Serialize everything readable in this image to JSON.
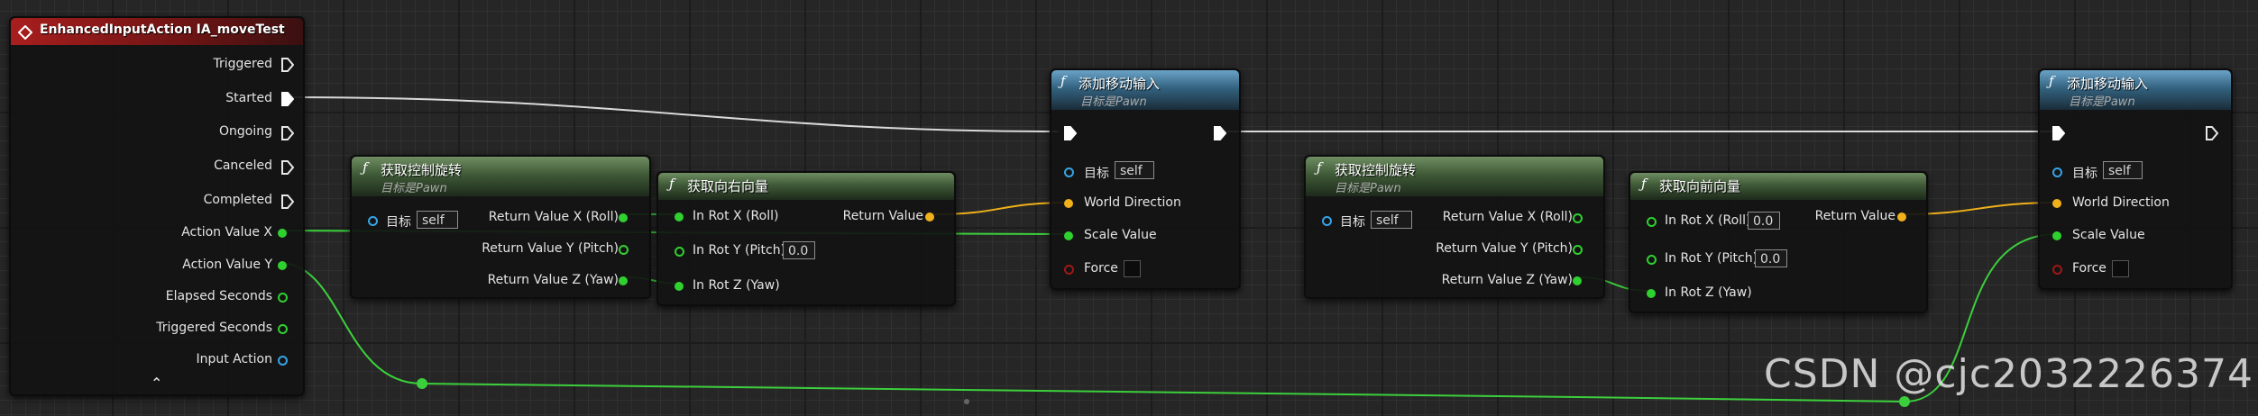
{
  "event_node": {
    "title": "EnhancedInputAction IA_moveTest",
    "pins": [
      "Triggered",
      "Started",
      "Ongoing",
      "Canceled",
      "Completed",
      "Action Value X",
      "Action Value Y",
      "Elapsed Seconds",
      "Triggered Seconds",
      "Input Action"
    ]
  },
  "get_control_rotation_1": {
    "title": "获取控制旋转",
    "subtitle": "目标是Pawn",
    "target_label": "目标",
    "target_value": "self",
    "outputs": [
      "Return Value X (Roll)",
      "Return Value Y (Pitch)",
      "Return Value Z (Yaw)"
    ]
  },
  "get_right_vector": {
    "title": "获取向右向量",
    "inputs": [
      "In Rot X (Roll)",
      "In Rot Y (Pitch)",
      "In Rot Z (Yaw)"
    ],
    "pitch_value": "0.0",
    "output": "Return Value"
  },
  "add_movement_input_1": {
    "title": "添加移动输入",
    "subtitle": "目标是Pawn",
    "target_label": "目标",
    "target_value": "self",
    "world_direction": "World Direction",
    "scale_value": "Scale Value",
    "force": "Force"
  },
  "get_control_rotation_2": {
    "title": "获取控制旋转",
    "subtitle": "目标是Pawn",
    "target_label": "目标",
    "target_value": "self",
    "outputs": [
      "Return Value X (Roll)",
      "Return Value Y (Pitch)",
      "Return Value Z (Yaw)"
    ]
  },
  "get_forward_vector": {
    "title": "获取向前向量",
    "inputs": [
      "In Rot X (Roll)",
      "In Rot Y (Pitch)",
      "In Rot Z (Yaw)"
    ],
    "roll_value": "0.0",
    "pitch_value": "0.0",
    "output": "Return Value"
  },
  "add_movement_input_2": {
    "title": "添加移动输入",
    "subtitle": "目标是Pawn",
    "target_label": "目标",
    "target_value": "self",
    "world_direction": "World Direction",
    "scale_value": "Scale Value",
    "force": "Force"
  },
  "function_symbol": "ƒ",
  "watermark": "CSDN @cjc2032226374",
  "colors": {
    "exec_wire": "#d9d9d9",
    "float_wire": "#3ccf3c",
    "vector_wire": "#f0b11a",
    "rotator_pin": "#35a4e6",
    "bool_pin": "#a01616",
    "event_header": "#a81e1e",
    "pure_header": "#4f7046",
    "callable_header": "#33627f"
  },
  "icons": {
    "event": "event-diamond-icon",
    "function": "function-f-icon",
    "exec": "exec-arrow-icon",
    "collapse": "chevron-up-icon"
  }
}
